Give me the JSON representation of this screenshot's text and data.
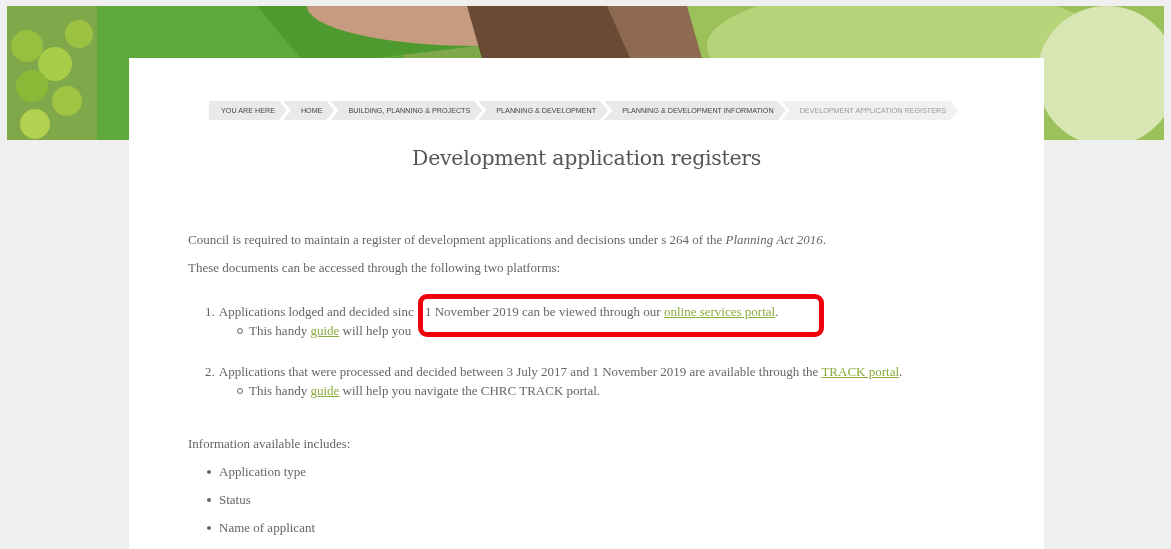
{
  "breadcrumb": [
    {
      "label": "YOU ARE HERE",
      "current": false
    },
    {
      "label": "HOME",
      "current": false
    },
    {
      "label": "BUILDING, PLANNING & PROJECTS",
      "current": false
    },
    {
      "label": "PLANNING & DEVELOPMENT",
      "current": false
    },
    {
      "label": "PLANNING & DEVELOPMENT INFORMATION",
      "current": false
    },
    {
      "label": "DEVELOPMENT APPLICATION REGISTERS",
      "current": true
    }
  ],
  "title": "Development application registers",
  "intro": [
    "Council is required to maintain a register of development applications and decisions under s 264 of the *Planning Act 2016*.",
    "These documents can be accessed through the following two platforms:"
  ],
  "platforms": [
    {
      "number": "1.",
      "segments": [
        {
          "kind": "text",
          "text": "Applications lodged and decided sinc "
        },
        {
          "kind": "text",
          "text": "1 November 2019 can be viewed through our "
        },
        {
          "kind": "link",
          "text": "online services portal"
        },
        {
          "kind": "text",
          "text": "."
        }
      ],
      "sub": [
        {
          "kind": "text",
          "text": "This handy "
        },
        {
          "kind": "link",
          "text": "guide"
        },
        {
          "kind": "text",
          "text": " will help you"
        }
      ]
    },
    {
      "number": "2.",
      "segments": [
        {
          "kind": "text",
          "text": "Applications that were processed and decided between 3 July 2017 and 1 November 2019 are available through the "
        },
        {
          "kind": "link",
          "text": "TRACK portal"
        },
        {
          "kind": "text",
          "text": "."
        }
      ],
      "sub": [
        {
          "kind": "text",
          "text": "This handy "
        },
        {
          "kind": "link",
          "text": "guide"
        },
        {
          "kind": "text",
          "text": " will help you navigate the CHRC TRACK portal."
        }
      ]
    }
  ],
  "info_heading": "Information available includes:",
  "info_items": [
    "Application type",
    "Status",
    "Name of applicant"
  ]
}
